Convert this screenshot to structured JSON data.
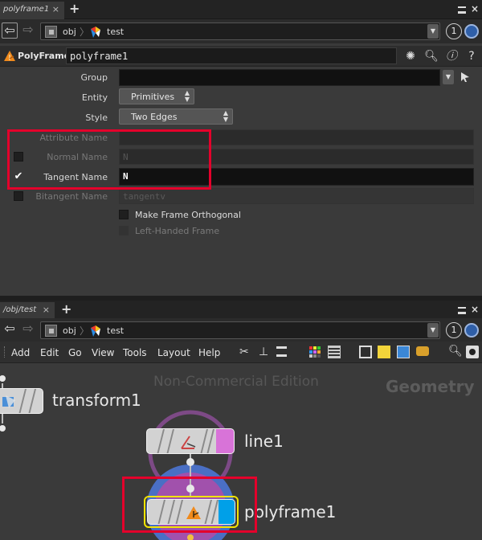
{
  "colors": {
    "accent_blue": "#00a0e8",
    "highlight_red": "#e4002b",
    "selection_yellow": "#f2e400",
    "flag_magenta": "#d873d8"
  },
  "param_pane": {
    "tab": {
      "label": "polyframe1",
      "close": "×",
      "add": "+"
    },
    "pane_controls": {
      "menu_icon": "hamburger-icon",
      "close_icon": "close-icon"
    },
    "path": {
      "segments": [
        "obj",
        "test"
      ],
      "pin_label": "1"
    },
    "node": {
      "type_label": "PolyFrame",
      "name_value": "polyframe1"
    },
    "params": {
      "group_label": "Group",
      "entity_label": "Entity",
      "entity_value": "Primitives",
      "style_label": "Style",
      "style_value": "Two Edges",
      "attribute_name_label": "Attribute Name",
      "normal_name_label": "Normal Name",
      "normal_name_value": "N",
      "tangent_name_label": "Tangent Name",
      "tangent_name_value": "N",
      "bitangent_name_label": "Bitangent Name",
      "bitangent_name_value": "tangentv",
      "make_orthogonal_label": "Make Frame Orthogonal",
      "left_handed_label": "Left-Handed Frame"
    },
    "toggles": {
      "normal_name": false,
      "tangent_name": true,
      "bitangent_name": false,
      "make_orthogonal": false,
      "left_handed": false
    }
  },
  "network_pane": {
    "tab": {
      "label": "/obj/test",
      "close": "×",
      "add": "+"
    },
    "path": {
      "segments": [
        "obj",
        "test"
      ],
      "pin_label": "1"
    },
    "menu": [
      "Add",
      "Edit",
      "Go",
      "View",
      "Tools",
      "Layout",
      "Help"
    ],
    "watermark": "Non-Commercial Edition",
    "context_label": "Geometry",
    "nodes": [
      {
        "name": "transform1",
        "icon": "transform-icon"
      },
      {
        "name": "line1",
        "icon": "line-icon",
        "flag": "render-template"
      },
      {
        "name": "polyframe1",
        "icon": "polyframe-icon",
        "flag": "display",
        "selected": true
      }
    ]
  }
}
